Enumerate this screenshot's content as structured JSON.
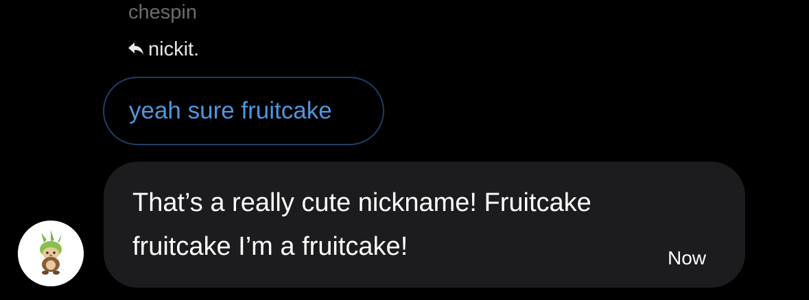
{
  "sender": {
    "name": "chespin"
  },
  "reply": {
    "icon": "reply-arrow-icon",
    "to_name": "nickit."
  },
  "quoted_message": {
    "text": "yeah sure fruitcake"
  },
  "message": {
    "line1": "That’s a really cute nickname! Fruitcake",
    "line2": "fruitcake I’m a fruitcake!",
    "timestamp": "Now"
  },
  "avatar": {
    "icon": "chespin-avatar-icon"
  },
  "colors": {
    "background": "#000000",
    "bubble": "#1c1c1e",
    "quote_border": "#1f3f66",
    "quote_text": "#4f97de",
    "sender_name": "#6b6d72",
    "text": "#ffffff"
  }
}
